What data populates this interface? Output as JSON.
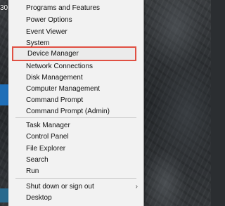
{
  "desktop": {
    "icon_label": "30"
  },
  "menu": {
    "group1": [
      "Programs and Features",
      "Power Options",
      "Event Viewer",
      "System"
    ],
    "device_manager": "Device Manager",
    "group2": [
      "Network Connections",
      "Disk Management",
      "Computer Management",
      "Command Prompt",
      "Command Prompt (Admin)"
    ],
    "group3": [
      "Task Manager",
      "Control Panel",
      "File Explorer",
      "Search",
      "Run"
    ],
    "shutdown": "Shut down or sign out",
    "desktop": "Desktop",
    "chevron": "›",
    "highlight_color": "#e05043"
  }
}
